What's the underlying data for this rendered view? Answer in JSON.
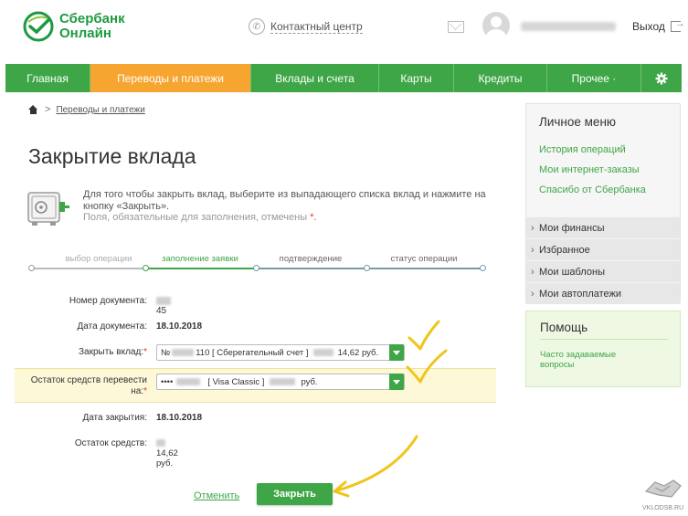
{
  "header": {
    "logo_line1": "Сбербанк",
    "logo_line2": "Онлайн",
    "contact_label": "Контактный центр",
    "logout_label": "Выход"
  },
  "nav": {
    "items": [
      {
        "label": "Главная",
        "active": false
      },
      {
        "label": "Переводы и платежи",
        "active": true
      },
      {
        "label": "Вклады и счета",
        "active": false
      },
      {
        "label": "Карты",
        "active": false
      },
      {
        "label": "Кредиты",
        "active": false
      },
      {
        "label": "Прочее ·",
        "active": false
      }
    ],
    "settings_icon": "gear-icon"
  },
  "breadcrumb": {
    "separator": ">",
    "link": "Переводы и платежи"
  },
  "page": {
    "title": "Закрытие вклада",
    "info_line": "Для того чтобы закрыть вклад, выберите из выпадающего списка вклад и нажмите на кнопку «Закрыть».",
    "required_note": "Поля, обязательные для заполнения, отмечены",
    "required_star": "*."
  },
  "steps": [
    {
      "label": "выбор операции",
      "state": "done"
    },
    {
      "label": "заполнение заявки",
      "state": "current"
    },
    {
      "label": "подтверждение",
      "state": "todo"
    },
    {
      "label": "статус операции",
      "state": "todo"
    }
  ],
  "form": {
    "doc_number_label": "Номер документа:",
    "doc_number_value": "45",
    "doc_date_label": "Дата документа:",
    "doc_date_value": "18.10.2018",
    "close_deposit_label": "Закрыть вклад:",
    "close_deposit_star": "*",
    "close_deposit_value_prefix": "№",
    "close_deposit_value_mid": "110  [ Сберегательный счет ]",
    "close_deposit_value_amount": "14,62  руб.",
    "transfer_label": "Остаток средств перевести на:",
    "transfer_star": "*",
    "transfer_value_prefix": "••••",
    "transfer_value_mid": "[ Visa Classic ]",
    "transfer_value_suffix": "руб.",
    "close_date_label": "Дата закрытия:",
    "close_date_value": "18.10.2018",
    "remainder_label": "Остаток средств:",
    "remainder_value": "14,62 руб."
  },
  "actions": {
    "cancel_label": "Отменить",
    "close_label": "Закрыть"
  },
  "sidebar": {
    "menu_title": "Личное меню",
    "links": [
      "История операций",
      "Мои интернет-заказы",
      "Спасибо от Сбербанка"
    ],
    "sections": [
      "Мои финансы",
      "Избранное",
      "Мои шаблоны",
      "Мои автоплатежи"
    ],
    "help_title": "Помощь",
    "help_link": "Часто задаваемые вопросы"
  },
  "watermark": {
    "text": "VKLODSB.RU"
  },
  "colors": {
    "brand_green": "#3fa648",
    "active_orange": "#f6a530",
    "annotation_yellow": "#f0c419"
  }
}
